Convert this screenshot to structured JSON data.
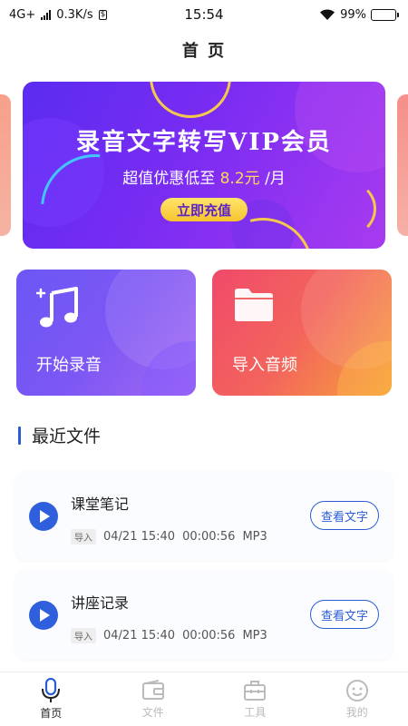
{
  "status_bar": {
    "network": "4G+",
    "speed": "0.3K/s",
    "time": "15:54",
    "battery": "99%",
    "battery_level": 0.99
  },
  "header": {
    "title": "首 页"
  },
  "banner": {
    "title": "录音文字转写VIP会员",
    "subtitle_prefix": "超值优惠低至",
    "price": "8.2元",
    "subtitle_suffix": "/月",
    "button": "立即充值"
  },
  "actions": {
    "record": {
      "label": "开始录音",
      "icon": "music-note-icon"
    },
    "import": {
      "label": "导入音频",
      "icon": "folder-icon"
    }
  },
  "recent": {
    "title": "最近文件",
    "files": [
      {
        "name": "课堂笔记",
        "tag": "导入",
        "date": "04/21 15:40",
        "duration": "00:00:56",
        "format": "MP3",
        "button": "查看文字"
      },
      {
        "name": "讲座记录",
        "tag": "导入",
        "date": "04/21 15:40",
        "duration": "00:00:56",
        "format": "MP3",
        "button": "查看文字"
      }
    ]
  },
  "tabs": [
    {
      "label": "首页",
      "icon": "microphone-icon",
      "active": true
    },
    {
      "label": "文件",
      "icon": "wallet-icon",
      "active": false
    },
    {
      "label": "工具",
      "icon": "toolbox-icon",
      "active": false
    },
    {
      "label": "我的",
      "icon": "smiley-icon",
      "active": false
    }
  ],
  "colors": {
    "accent": "#2b5cd6",
    "banner_start": "#5a2cf0",
    "banner_end": "#a83bf0",
    "record_card": "#7d57f4",
    "import_card": "#f3655c"
  }
}
